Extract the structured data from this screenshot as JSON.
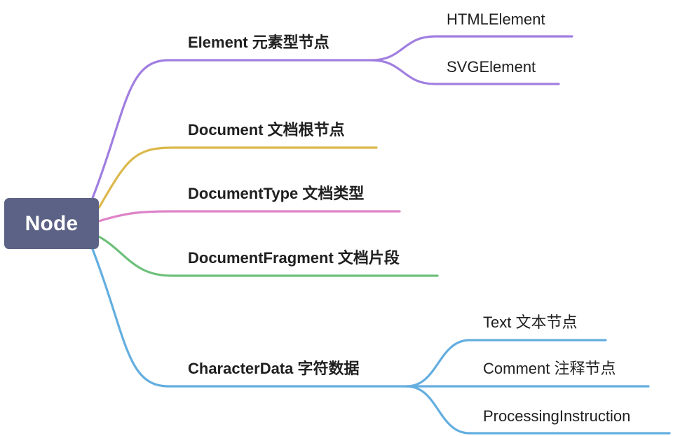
{
  "root": {
    "label": "Node"
  },
  "branches": [
    {
      "label": "Element 元素型节点",
      "color": "#a07ee0",
      "children": [
        {
          "label": "HTMLElement"
        },
        {
          "label": "SVGElement"
        }
      ]
    },
    {
      "label": "Document 文档根节点",
      "color": "#dcb84a",
      "children": []
    },
    {
      "label": "DocumentType 文档类型",
      "color": "#dd84c8",
      "children": []
    },
    {
      "label": "DocumentFragment 文档片段",
      "color": "#6dc07a",
      "children": []
    },
    {
      "label": "CharacterData 字符数据",
      "color": "#63aee0",
      "children": [
        {
          "label": "Text 文本节点"
        },
        {
          "label": "Comment 注释节点"
        },
        {
          "label": "ProcessingInstruction"
        }
      ]
    }
  ]
}
